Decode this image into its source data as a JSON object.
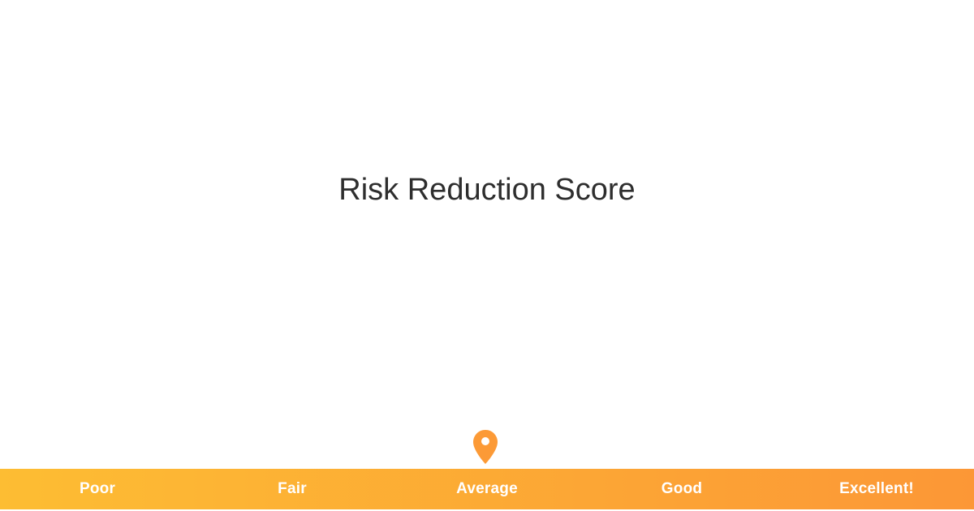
{
  "title": "Risk Reduction Score",
  "scale": {
    "levels": [
      "Poor",
      "Fair",
      "Average",
      "Good",
      "Excellent!"
    ],
    "current_index": 2,
    "current_level": "Average",
    "gradient": {
      "start": "#fdbd33",
      "end": "#fc9736"
    }
  },
  "marker": {
    "icon": "map-pin-icon",
    "color": "#fc9a36"
  }
}
